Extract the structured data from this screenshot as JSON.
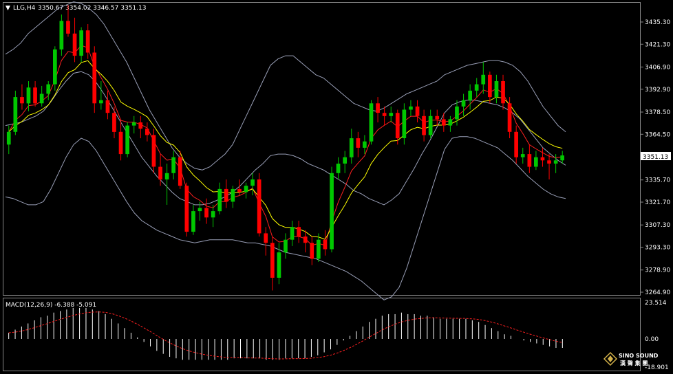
{
  "header": {
    "symbol": "LLG,H4",
    "ohlc": "3350.67 3354.02 3346.57 3351.13",
    "dropdown_glyph": "▼"
  },
  "price_axis": {
    "labels": [
      "3435.30",
      "3421.30",
      "3406.90",
      "3392.90",
      "3378.50",
      "3364.50",
      "3349.70",
      "3335.70",
      "3321.70",
      "3307.30",
      "3293.30",
      "3278.90",
      "3264.90"
    ],
    "current_price": "3351.13"
  },
  "macd": {
    "label": "MACD(12,26,9) -6.388 -5.091",
    "axis_labels": [
      "23.514",
      "0.00",
      "-18.901"
    ]
  },
  "logo": {
    "line1": "SINO SOUND",
    "line2": "漢 聲 集 團"
  },
  "colors": {
    "background": "#000000",
    "up": "#00c800",
    "down": "#ff0000",
    "ma_fast": "#ff2020",
    "ma_slow": "#ffff00",
    "bands": "#9aa0b8",
    "macd_hist": "#ffffff",
    "macd_signal": "#ff2020"
  },
  "chart_data": [
    {
      "type": "candlestick",
      "title": "LLG,H4",
      "ylim": [
        3264.9,
        3435.3
      ],
      "indicators": [
        "Bollinger Bands",
        "Moving average (red)",
        "Moving average (yellow)"
      ],
      "candles": [
        {
          "o": 3358,
          "h": 3370,
          "l": 3352,
          "c": 3366
        },
        {
          "o": 3366,
          "h": 3392,
          "l": 3364,
          "c": 3388
        },
        {
          "o": 3388,
          "h": 3396,
          "l": 3380,
          "c": 3384
        },
        {
          "o": 3384,
          "h": 3398,
          "l": 3379,
          "c": 3394
        },
        {
          "o": 3394,
          "h": 3398,
          "l": 3382,
          "c": 3384
        },
        {
          "o": 3384,
          "h": 3395,
          "l": 3382,
          "c": 3390
        },
        {
          "o": 3390,
          "h": 3398,
          "l": 3386,
          "c": 3396
        },
        {
          "o": 3396,
          "h": 3420,
          "l": 3392,
          "c": 3418
        },
        {
          "o": 3418,
          "h": 3440,
          "l": 3414,
          "c": 3436
        },
        {
          "o": 3436,
          "h": 3446,
          "l": 3426,
          "c": 3428
        },
        {
          "o": 3428,
          "h": 3438,
          "l": 3410,
          "c": 3414
        },
        {
          "o": 3414,
          "h": 3432,
          "l": 3410,
          "c": 3430
        },
        {
          "o": 3430,
          "h": 3434,
          "l": 3412,
          "c": 3416
        },
        {
          "o": 3416,
          "h": 3420,
          "l": 3378,
          "c": 3384
        },
        {
          "o": 3384,
          "h": 3398,
          "l": 3380,
          "c": 3386
        },
        {
          "o": 3386,
          "h": 3392,
          "l": 3374,
          "c": 3378
        },
        {
          "o": 3378,
          "h": 3382,
          "l": 3362,
          "c": 3366
        },
        {
          "o": 3366,
          "h": 3374,
          "l": 3348,
          "c": 3352
        },
        {
          "o": 3352,
          "h": 3372,
          "l": 3350,
          "c": 3370
        },
        {
          "o": 3370,
          "h": 3376,
          "l": 3365,
          "c": 3372
        },
        {
          "o": 3372,
          "h": 3376,
          "l": 3362,
          "c": 3368
        },
        {
          "o": 3368,
          "h": 3372,
          "l": 3360,
          "c": 3364
        },
        {
          "o": 3364,
          "h": 3368,
          "l": 3340,
          "c": 3344
        },
        {
          "o": 3344,
          "h": 3352,
          "l": 3332,
          "c": 3336
        },
        {
          "o": 3336,
          "h": 3346,
          "l": 3320,
          "c": 3340
        },
        {
          "o": 3340,
          "h": 3354,
          "l": 3336,
          "c": 3350
        },
        {
          "o": 3350,
          "h": 3354,
          "l": 3330,
          "c": 3332
        },
        {
          "o": 3332,
          "h": 3334,
          "l": 3300,
          "c": 3303
        },
        {
          "o": 3303,
          "h": 3320,
          "l": 3301,
          "c": 3316
        },
        {
          "o": 3316,
          "h": 3322,
          "l": 3310,
          "c": 3318
        },
        {
          "o": 3318,
          "h": 3324,
          "l": 3308,
          "c": 3312
        },
        {
          "o": 3312,
          "h": 3320,
          "l": 3306,
          "c": 3316
        },
        {
          "o": 3316,
          "h": 3334,
          "l": 3314,
          "c": 3330
        },
        {
          "o": 3330,
          "h": 3336,
          "l": 3318,
          "c": 3322
        },
        {
          "o": 3322,
          "h": 3332,
          "l": 3318,
          "c": 3330
        },
        {
          "o": 3330,
          "h": 3336,
          "l": 3326,
          "c": 3328
        },
        {
          "o": 3328,
          "h": 3334,
          "l": 3324,
          "c": 3332
        },
        {
          "o": 3332,
          "h": 3340,
          "l": 3326,
          "c": 3336
        },
        {
          "o": 3336,
          "h": 3340,
          "l": 3300,
          "c": 3302
        },
        {
          "o": 3302,
          "h": 3306,
          "l": 3288,
          "c": 3296
        },
        {
          "o": 3296,
          "h": 3300,
          "l": 3266,
          "c": 3274
        },
        {
          "o": 3274,
          "h": 3296,
          "l": 3270,
          "c": 3290
        },
        {
          "o": 3290,
          "h": 3302,
          "l": 3286,
          "c": 3298
        },
        {
          "o": 3298,
          "h": 3310,
          "l": 3294,
          "c": 3306
        },
        {
          "o": 3306,
          "h": 3310,
          "l": 3296,
          "c": 3300
        },
        {
          "o": 3300,
          "h": 3304,
          "l": 3290,
          "c": 3296
        },
        {
          "o": 3296,
          "h": 3300,
          "l": 3282,
          "c": 3286
        },
        {
          "o": 3286,
          "h": 3302,
          "l": 3284,
          "c": 3298
        },
        {
          "o": 3298,
          "h": 3304,
          "l": 3288,
          "c": 3292
        },
        {
          "o": 3292,
          "h": 3344,
          "l": 3290,
          "c": 3340
        },
        {
          "o": 3340,
          "h": 3350,
          "l": 3336,
          "c": 3346
        },
        {
          "o": 3346,
          "h": 3354,
          "l": 3340,
          "c": 3350
        },
        {
          "o": 3350,
          "h": 3368,
          "l": 3346,
          "c": 3362
        },
        {
          "o": 3362,
          "h": 3366,
          "l": 3350,
          "c": 3356
        },
        {
          "o": 3356,
          "h": 3364,
          "l": 3352,
          "c": 3360
        },
        {
          "o": 3360,
          "h": 3386,
          "l": 3358,
          "c": 3384
        },
        {
          "o": 3384,
          "h": 3388,
          "l": 3372,
          "c": 3378
        },
        {
          "o": 3378,
          "h": 3382,
          "l": 3370,
          "c": 3376
        },
        {
          "o": 3376,
          "h": 3382,
          "l": 3372,
          "c": 3378
        },
        {
          "o": 3378,
          "h": 3380,
          "l": 3358,
          "c": 3362
        },
        {
          "o": 3362,
          "h": 3384,
          "l": 3358,
          "c": 3380
        },
        {
          "o": 3380,
          "h": 3386,
          "l": 3376,
          "c": 3382
        },
        {
          "o": 3382,
          "h": 3386,
          "l": 3372,
          "c": 3376
        },
        {
          "o": 3376,
          "h": 3380,
          "l": 3360,
          "c": 3364
        },
        {
          "o": 3364,
          "h": 3380,
          "l": 3362,
          "c": 3376
        },
        {
          "o": 3376,
          "h": 3380,
          "l": 3370,
          "c": 3374
        },
        {
          "o": 3374,
          "h": 3378,
          "l": 3366,
          "c": 3370
        },
        {
          "o": 3370,
          "h": 3376,
          "l": 3366,
          "c": 3374
        },
        {
          "o": 3374,
          "h": 3386,
          "l": 3370,
          "c": 3382
        },
        {
          "o": 3382,
          "h": 3390,
          "l": 3376,
          "c": 3386
        },
        {
          "o": 3386,
          "h": 3396,
          "l": 3380,
          "c": 3392
        },
        {
          "o": 3392,
          "h": 3400,
          "l": 3388,
          "c": 3396
        },
        {
          "o": 3396,
          "h": 3410,
          "l": 3390,
          "c": 3402
        },
        {
          "o": 3402,
          "h": 3404,
          "l": 3384,
          "c": 3388
        },
        {
          "o": 3388,
          "h": 3402,
          "l": 3384,
          "c": 3398
        },
        {
          "o": 3398,
          "h": 3402,
          "l": 3380,
          "c": 3384
        },
        {
          "o": 3384,
          "h": 3388,
          "l": 3362,
          "c": 3366
        },
        {
          "o": 3366,
          "h": 3370,
          "l": 3346,
          "c": 3350
        },
        {
          "o": 3350,
          "h": 3356,
          "l": 3346,
          "c": 3352
        },
        {
          "o": 3352,
          "h": 3358,
          "l": 3340,
          "c": 3344
        },
        {
          "o": 3344,
          "h": 3354,
          "l": 3342,
          "c": 3350
        },
        {
          "o": 3350,
          "h": 3356,
          "l": 3344,
          "c": 3348
        },
        {
          "o": 3348,
          "h": 3352,
          "l": 3336,
          "c": 3346
        },
        {
          "o": 3346,
          "h": 3352,
          "l": 3340,
          "c": 3348
        },
        {
          "o": 3348,
          "h": 3354,
          "l": 3346,
          "c": 3351.13
        }
      ],
      "bollinger_upper": [
        3415,
        3418,
        3422,
        3428,
        3432,
        3436,
        3440,
        3444,
        3446,
        3448,
        3447,
        3444,
        3440,
        3434,
        3426,
        3418,
        3410,
        3400,
        3390,
        3380,
        3372,
        3364,
        3356,
        3350,
        3346,
        3343,
        3342,
        3344,
        3348,
        3352,
        3358,
        3368,
        3378,
        3388,
        3398,
        3408,
        3412,
        3414,
        3414,
        3410,
        3406,
        3402,
        3400,
        3396,
        3392,
        3388,
        3384,
        3382,
        3380,
        3379,
        3381,
        3384,
        3387,
        3390,
        3392,
        3394,
        3396,
        3398,
        3402,
        3404,
        3406,
        3408,
        3409,
        3410,
        3411,
        3411,
        3410,
        3408,
        3404,
        3398,
        3390,
        3382,
        3376,
        3370,
        3366
      ],
      "bollinger_lower": [
        3325,
        3324,
        3322,
        3320,
        3320,
        3322,
        3330,
        3340,
        3350,
        3358,
        3362,
        3360,
        3354,
        3346,
        3338,
        3330,
        3322,
        3315,
        3310,
        3307,
        3304,
        3302,
        3300,
        3298,
        3297,
        3296,
        3297,
        3298,
        3298,
        3298,
        3298,
        3297,
        3296,
        3296,
        3295,
        3294,
        3292,
        3290,
        3289,
        3288,
        3287,
        3286,
        3284,
        3282,
        3280,
        3278,
        3275,
        3272,
        3268,
        3264,
        3260,
        3262,
        3268,
        3280,
        3295,
        3310,
        3325,
        3340,
        3355,
        3362,
        3363,
        3363,
        3362,
        3360,
        3358,
        3356,
        3352,
        3348,
        3343,
        3338,
        3334,
        3330,
        3327,
        3325,
        3324
      ],
      "bollinger_mid": [
        3370,
        3371,
        3372,
        3374,
        3376,
        3379,
        3385,
        3392,
        3398,
        3403,
        3404,
        3402,
        3397,
        3390,
        3382,
        3374,
        3366,
        3358,
        3350,
        3344,
        3338,
        3333,
        3328,
        3324,
        3322,
        3320,
        3320,
        3321,
        3323,
        3325,
        3328,
        3332,
        3337,
        3342,
        3346,
        3351,
        3352,
        3352,
        3351,
        3349,
        3346,
        3344,
        3342,
        3339,
        3336,
        3333,
        3329,
        3327,
        3324,
        3322,
        3320,
        3323,
        3327,
        3335,
        3343,
        3352,
        3360,
        3369,
        3378,
        3383,
        3385,
        3386,
        3386,
        3385,
        3384,
        3383,
        3381,
        3378,
        3374,
        3368,
        3362,
        3356,
        3352,
        3348,
        3345
      ],
      "macd_hist": [
        4,
        6,
        8,
        10,
        12,
        14,
        15,
        17,
        18,
        19,
        20,
        20,
        20,
        19,
        18,
        16,
        13,
        10,
        7,
        4,
        1,
        -2,
        -5,
        -8,
        -10,
        -12,
        -13,
        -14,
        -14,
        -14,
        -14,
        -14,
        -14,
        -14,
        -14,
        -13,
        -13,
        -13,
        -13,
        -13,
        -14,
        -14,
        -14,
        -13,
        -13,
        -13,
        -13,
        -12,
        -11,
        -9,
        -7,
        -4,
        -1,
        2,
        5,
        8,
        11,
        13,
        15,
        16,
        16,
        17,
        16,
        16,
        15,
        15,
        14,
        13,
        13,
        13,
        13,
        13,
        12,
        11,
        9,
        7,
        5,
        3,
        2,
        0,
        -1,
        -2,
        -3,
        -4,
        -5,
        -6,
        -6
      ]
    }
  ]
}
